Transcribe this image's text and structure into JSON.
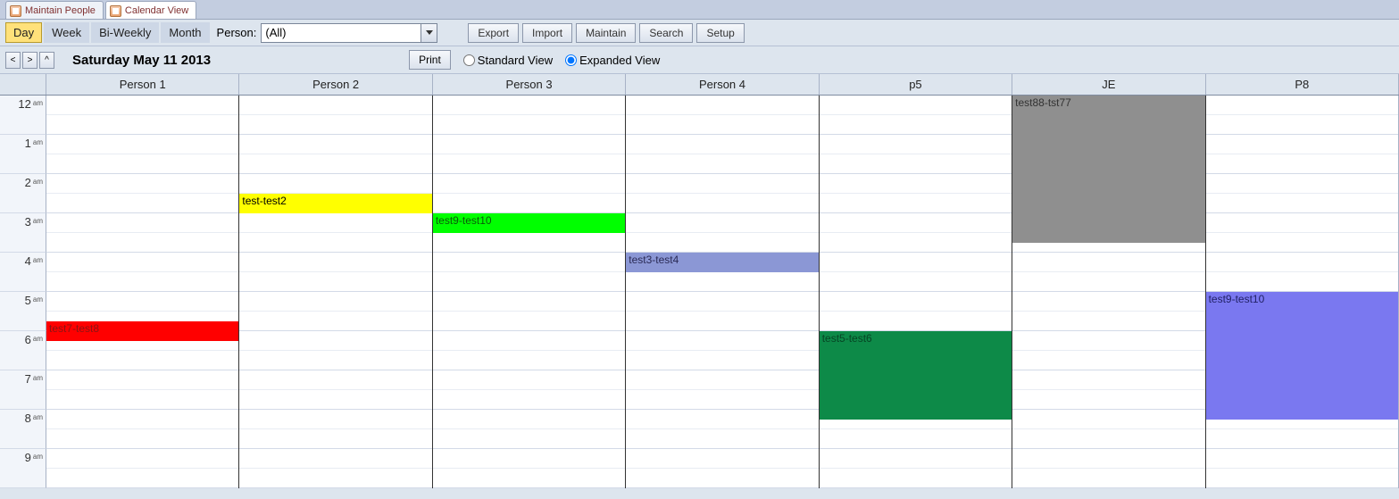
{
  "tabs": [
    {
      "label": "Maintain People",
      "active": false
    },
    {
      "label": "Calendar View",
      "active": true
    }
  ],
  "views": {
    "day": "Day",
    "week": "Week",
    "biweekly": "Bi-Weekly",
    "month": "Month",
    "active": "day"
  },
  "person_label": "Person:",
  "person_value": "(All)",
  "buttons": {
    "export": "Export",
    "import": "Import",
    "maintain": "Maintain",
    "search": "Search",
    "setup": "Setup",
    "print": "Print"
  },
  "nav": {
    "prev": "<",
    "next": ">",
    "up": "^"
  },
  "date_label": "Saturday May 11 2013",
  "view_mode": {
    "standard": "Standard View",
    "expanded": "Expanded View",
    "selected": "expanded"
  },
  "columns": [
    "Person 1",
    "Person 2",
    "Person 3",
    "Person 4",
    "p5",
    "JE",
    "P8"
  ],
  "hours": [
    "12",
    "1",
    "2",
    "3",
    "4",
    "5",
    "6",
    "7",
    "8",
    "9"
  ],
  "ampm": "am",
  "events": [
    {
      "col": 0,
      "label": "test7-test8",
      "startHour": 5.75,
      "endHour": 6.25,
      "color": "#ff0000",
      "text": "#8a1515"
    },
    {
      "col": 1,
      "label": "test-test2",
      "startHour": 2.5,
      "endHour": 3.0,
      "color": "#ffff00",
      "text": "#000000"
    },
    {
      "col": 2,
      "label": "test9-test10",
      "startHour": 3.0,
      "endHour": 3.5,
      "color": "#00ff00",
      "text": "#0a5a0a"
    },
    {
      "col": 3,
      "label": "test3-test4",
      "startHour": 4.0,
      "endHour": 4.5,
      "color": "#8b97d5",
      "text": "#2a2a55"
    },
    {
      "col": 4,
      "label": "test5-test6",
      "startHour": 6.0,
      "endHour": 8.25,
      "color": "#0d8a48",
      "text": "#064524"
    },
    {
      "col": 5,
      "label": "test88-tst77",
      "startHour": 0.0,
      "endHour": 3.75,
      "color": "#8f8f8f",
      "text": "#333333"
    },
    {
      "col": 6,
      "label": "test9-test10",
      "startHour": 5.0,
      "endHour": 8.25,
      "color": "#7a78f0",
      "text": "#222266"
    }
  ]
}
